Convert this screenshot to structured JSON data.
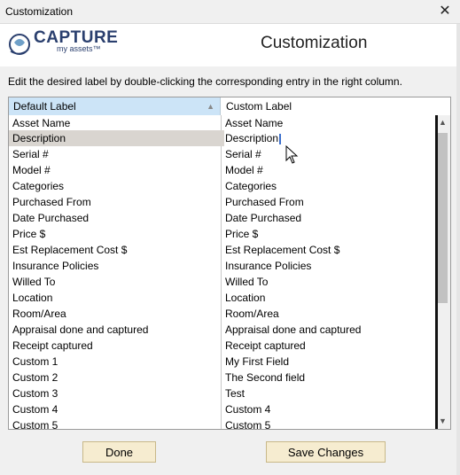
{
  "window": {
    "title": "Customization",
    "close_symbol": "✕"
  },
  "header": {
    "logo_text_main": "CAPTURE",
    "logo_text_sub": "my assets™",
    "heading": "Customization"
  },
  "instructions": "Edit the desired label by double-clicking the corresponding entry in the right column.",
  "grid": {
    "columns": [
      "Default Label",
      "Custom Label"
    ],
    "sort_indicator": "▲",
    "selected_row": 1,
    "rows": [
      {
        "default": "Asset Name",
        "custom": "Asset Name"
      },
      {
        "default": "Description",
        "custom": "Description"
      },
      {
        "default": "Serial #",
        "custom": "Serial #"
      },
      {
        "default": "Model #",
        "custom": "Model #"
      },
      {
        "default": "Categories",
        "custom": "Categories"
      },
      {
        "default": "Purchased From",
        "custom": "Purchased From"
      },
      {
        "default": "Date Purchased",
        "custom": "Date Purchased"
      },
      {
        "default": "Price $",
        "custom": "Price $"
      },
      {
        "default": "Est Replacement Cost $",
        "custom": "Est Replacement Cost $"
      },
      {
        "default": "Insurance Policies",
        "custom": "Insurance Policies"
      },
      {
        "default": "Willed To",
        "custom": "Willed To"
      },
      {
        "default": "Location",
        "custom": "Location"
      },
      {
        "default": "Room/Area",
        "custom": "Room/Area"
      },
      {
        "default": "Appraisal done and captured",
        "custom": "Appraisal done and captured"
      },
      {
        "default": "Receipt captured",
        "custom": "Receipt captured"
      },
      {
        "default": "Custom 1",
        "custom": "My First Field"
      },
      {
        "default": "Custom 2",
        "custom": "The Second field"
      },
      {
        "default": "Custom 3",
        "custom": "Test"
      },
      {
        "default": "Custom 4",
        "custom": "Custom 4"
      },
      {
        "default": "Custom 5",
        "custom": "Custom 5"
      }
    ]
  },
  "buttons": {
    "done": "Done",
    "save": "Save Changes"
  },
  "scroll": {
    "up": "▲",
    "down": "▼"
  }
}
